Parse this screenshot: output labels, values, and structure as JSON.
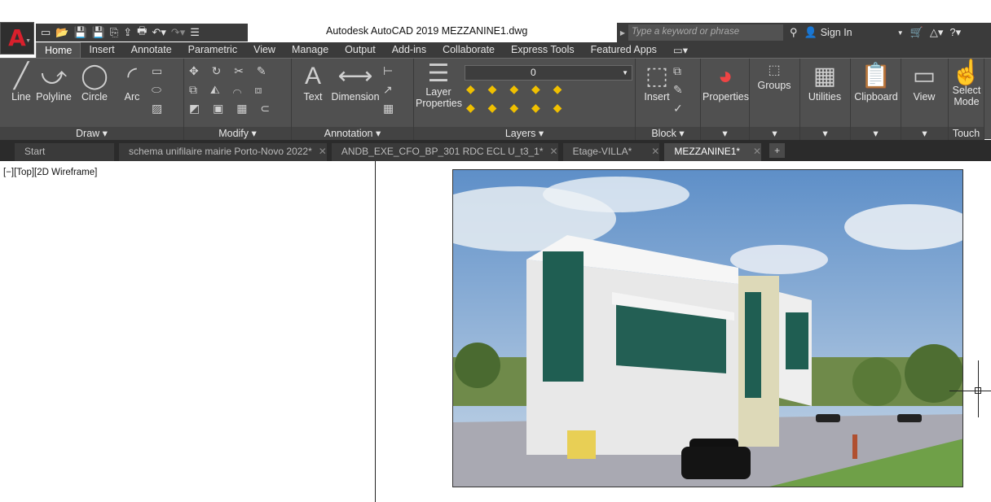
{
  "window": {
    "title": "Autodesk AutoCAD 2019    MEZZANINE1.dwg"
  },
  "search": {
    "placeholder": "Type a keyword or phrase"
  },
  "account": {
    "sign_in": "Sign In"
  },
  "ribbon_tabs": [
    "Home",
    "Insert",
    "Annotate",
    "Parametric",
    "View",
    "Manage",
    "Output",
    "Add-ins",
    "Collaborate",
    "Express Tools",
    "Featured Apps"
  ],
  "panels": {
    "draw": {
      "label": "Draw",
      "tools": [
        "Line",
        "Polyline",
        "Circle",
        "Arc"
      ]
    },
    "modify": {
      "label": "Modify"
    },
    "annotation": {
      "label": "Annotation",
      "tools": [
        "Text",
        "Dimension"
      ]
    },
    "layers": {
      "label": "Layers",
      "tool": "Layer",
      "tool2": "Properties",
      "current_layer": "0"
    },
    "block": {
      "label": "Block",
      "tool": "Insert"
    },
    "properties": {
      "tool": "Properties"
    },
    "groups": {
      "tool": "Groups"
    },
    "utilities": {
      "tool": "Utilities"
    },
    "clipboard": {
      "tool": "Clipboard"
    },
    "view": {
      "tool": "View"
    },
    "touch": {
      "label": "Touch",
      "tool": "Select",
      "tool2": "Mode"
    }
  },
  "doc_tabs": [
    {
      "label": "Start"
    },
    {
      "label": "schema unifilaire mairie Porto-Novo 2022*"
    },
    {
      "label": "ANDB_EXE_CFO_BP_301 RDC ECL U_t3_1*"
    },
    {
      "label": "Etage-VILLA*"
    },
    {
      "label": "MEZZANINE1*"
    }
  ],
  "viewport": {
    "label": "[−][Top][2D Wireframe]"
  },
  "colors": {
    "ribbon": "#505050",
    "app_red": "#d8202c",
    "tabs_bg": "#2b2b2b"
  }
}
